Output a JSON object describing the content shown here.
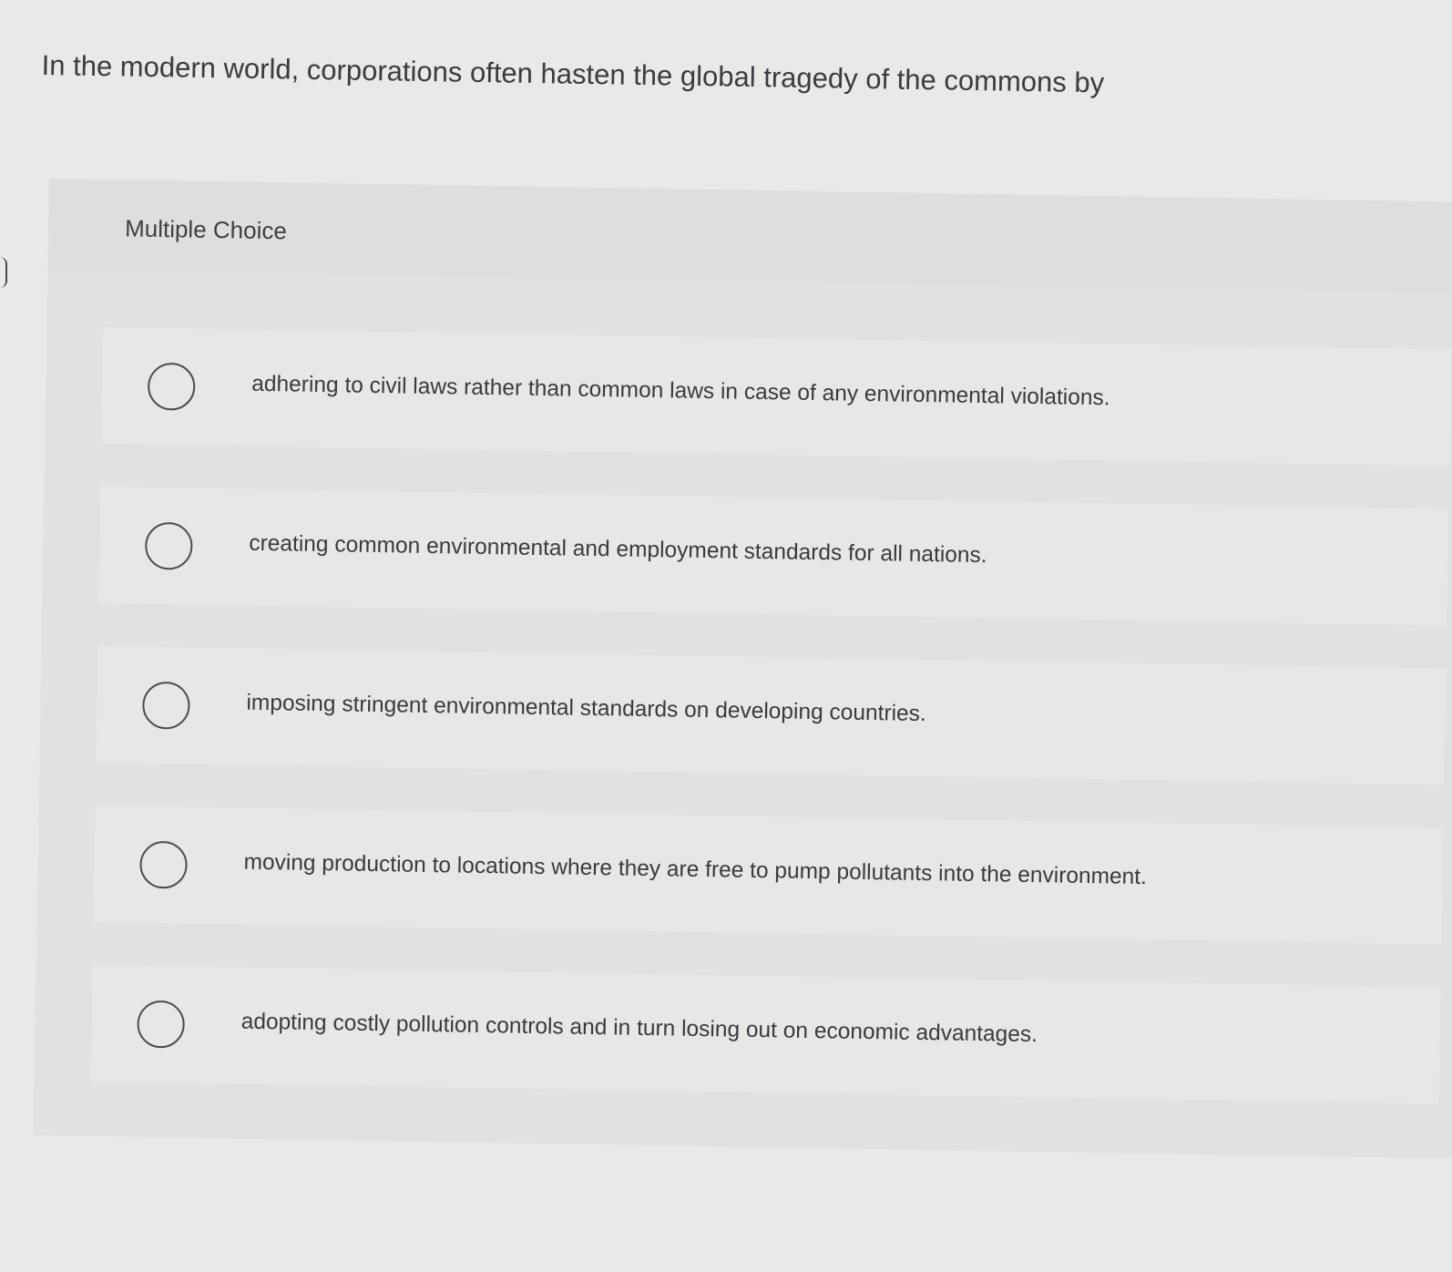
{
  "question": {
    "text": "In the modern world, corporations often hasten the global tragedy of the commons by"
  },
  "multiple_choice": {
    "label": "Multiple Choice",
    "options": [
      {
        "text": "adhering to civil laws rather than common laws in case of any environmental violations.",
        "selected": false
      },
      {
        "text": "creating common environmental and employment standards for all nations.",
        "selected": false
      },
      {
        "text": "imposing stringent environmental standards on developing countries.",
        "selected": false
      },
      {
        "text": "moving production to locations where they are free to pump pollutants into the environment.",
        "selected": false
      },
      {
        "text": "adopting costly pollution controls and in turn losing out on economic advantages.",
        "selected": false
      }
    ]
  }
}
